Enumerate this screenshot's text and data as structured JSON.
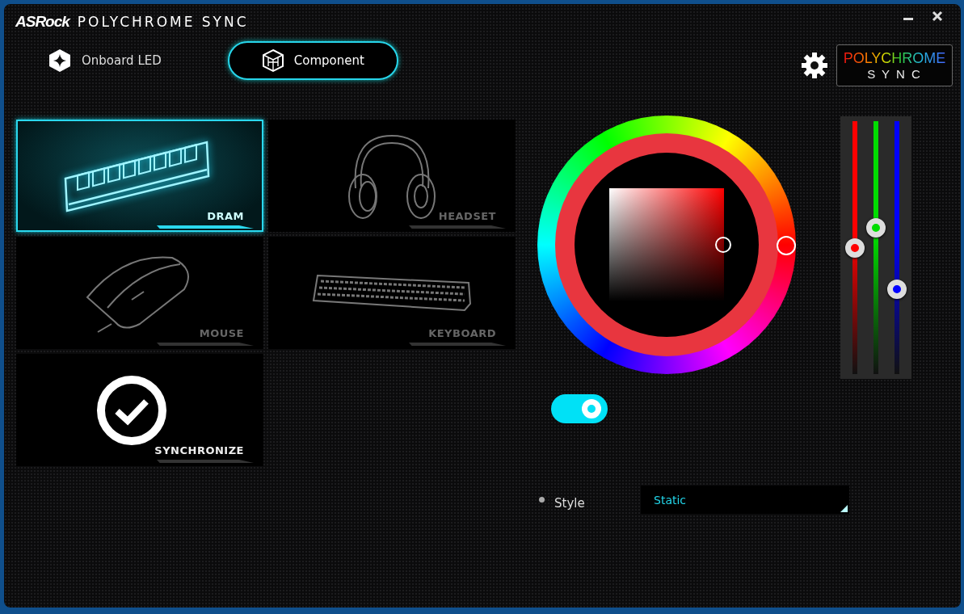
{
  "window": {
    "brand": "ASRock",
    "title": "POLYCHROME SYNC"
  },
  "tabs": [
    {
      "label": "Onboard LED",
      "kind": "led",
      "selected": false
    },
    {
      "label": "Component",
      "kind": "component",
      "selected": true
    }
  ],
  "logo": {
    "top": "POLYCHROME",
    "bottom": "S Y N C"
  },
  "components": [
    {
      "label": "DRAM",
      "kind": "dram",
      "selected": true
    },
    {
      "label": "HEADSET",
      "kind": "headset",
      "selected": false
    },
    {
      "label": "MOUSE",
      "kind": "mouse",
      "selected": false
    },
    {
      "label": "KEYBOARD",
      "kind": "keyboard",
      "selected": false
    },
    {
      "label": "SYNCHRONIZE",
      "kind": "sync",
      "selected": false
    }
  ],
  "rgb_sliders": [
    {
      "color": "#ff0000",
      "level": 0.5
    },
    {
      "color": "#00dd00",
      "level": 0.58
    },
    {
      "color": "#0000ff",
      "level": 0.33
    }
  ],
  "toggle": {
    "on": true
  },
  "style": {
    "label": "Style",
    "value": "Static"
  }
}
